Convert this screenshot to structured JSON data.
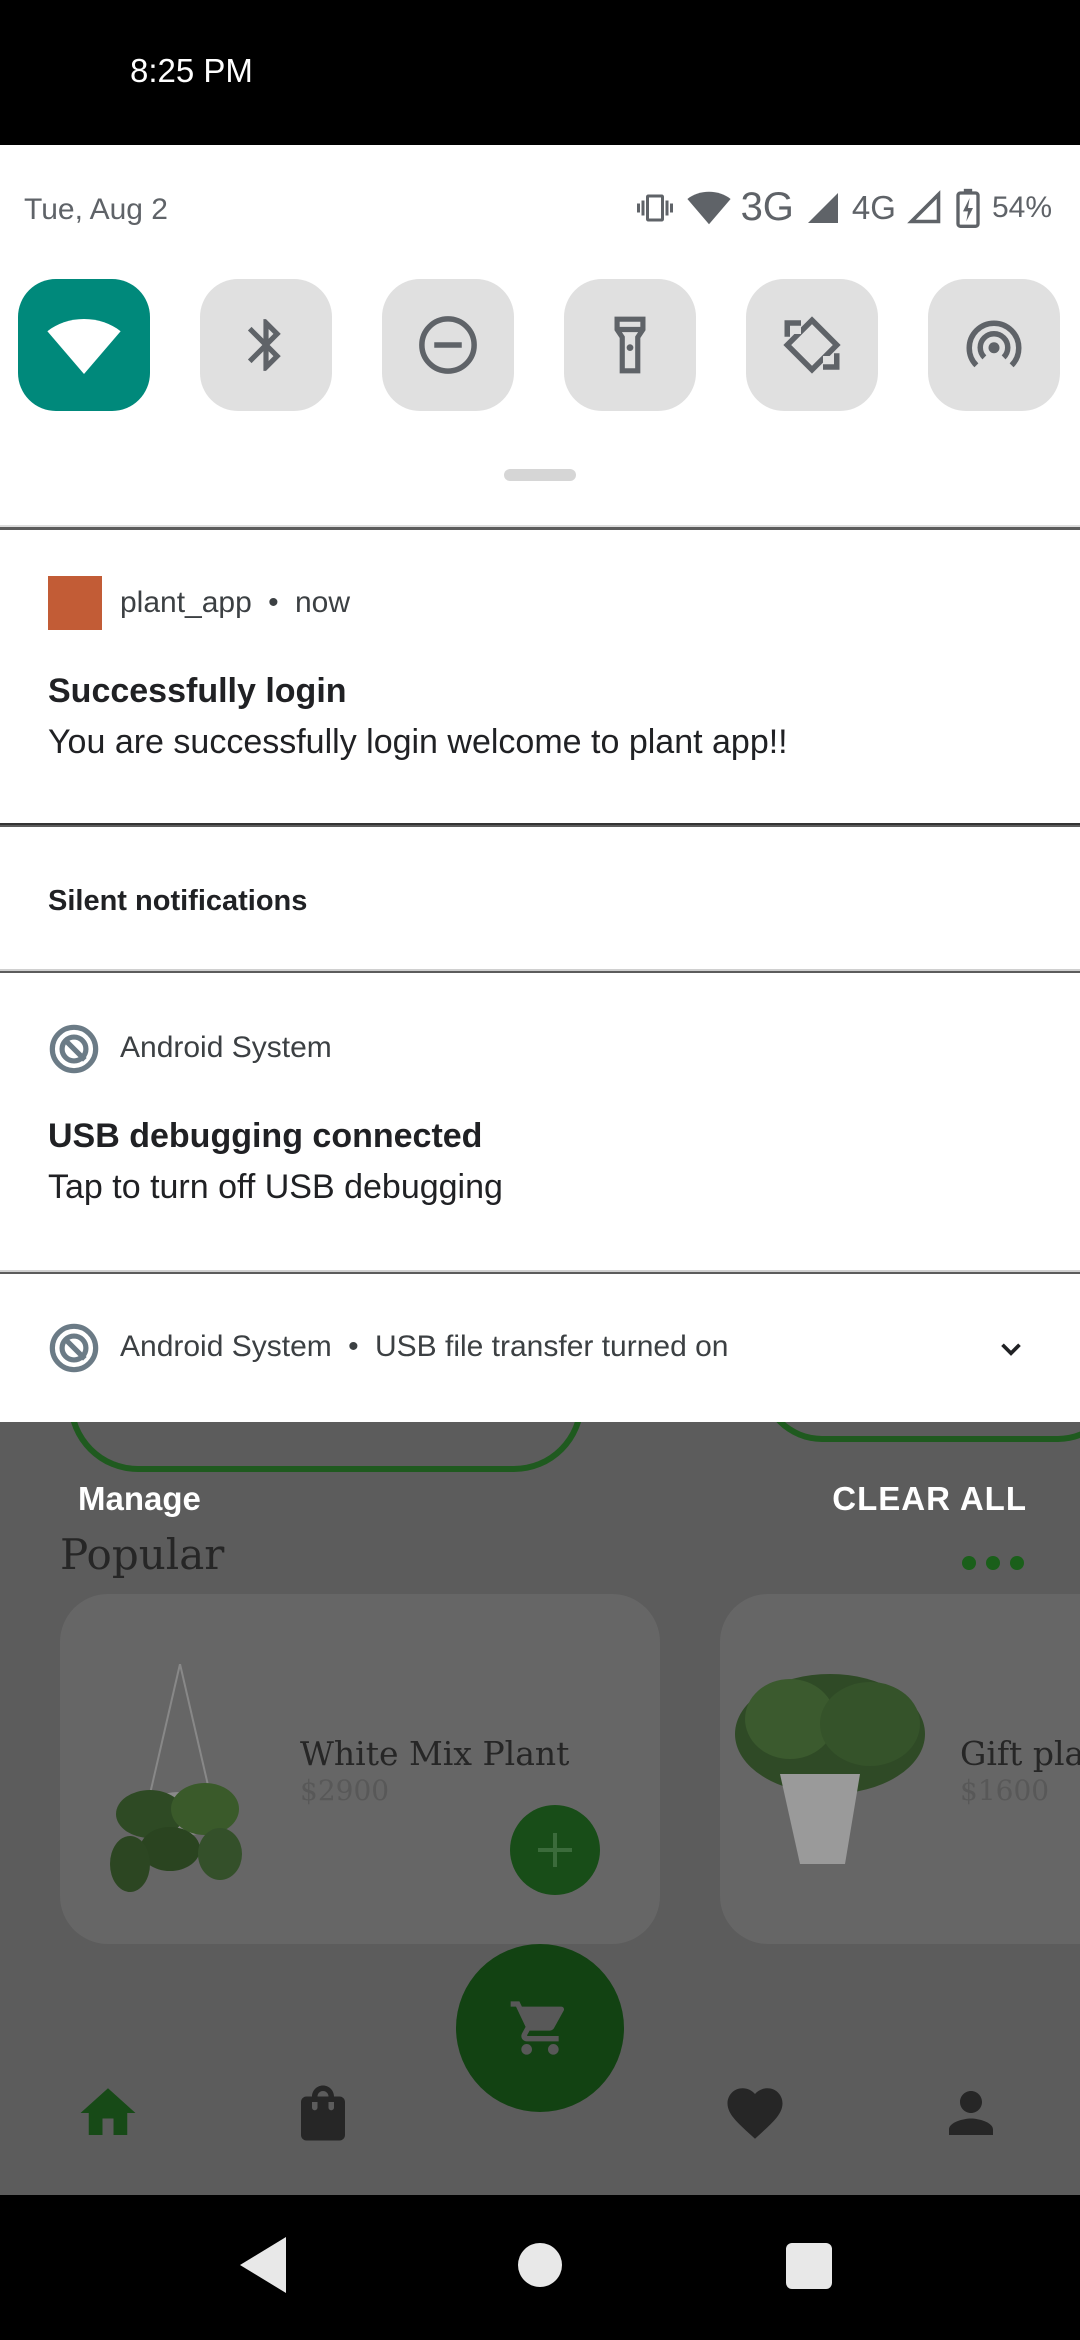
{
  "status_bar": {
    "time": "8:25 PM"
  },
  "quick_settings": {
    "date": "Tue, Aug 2",
    "network_3g": "3G",
    "network_4g": "4G",
    "battery": "54%",
    "tiles": [
      {
        "icon": "wifi-icon",
        "active": true
      },
      {
        "icon": "bluetooth-icon",
        "active": false
      },
      {
        "icon": "do-not-disturb-icon",
        "active": false
      },
      {
        "icon": "flashlight-icon",
        "active": false
      },
      {
        "icon": "auto-rotate-icon",
        "active": false
      },
      {
        "icon": "hotspot-icon",
        "active": false
      }
    ],
    "active_color": "#00897b"
  },
  "notifications": {
    "plant": {
      "app": "plant_app",
      "separator": "•",
      "time": "now",
      "title": "Successfully login",
      "text": "You are successfully login welcome to plant app!!",
      "app_color": "#c25c36"
    },
    "silent_header": "Silent notifications",
    "usb_debug": {
      "app": "Android System",
      "title": "USB debugging connected",
      "text": "Tap to turn off USB debugging"
    },
    "usb_transfer": {
      "app": "Android System",
      "separator": "•",
      "text": "USB file transfer turned on"
    }
  },
  "shade_actions": {
    "manage": "Manage",
    "clear_all": "CLEAR ALL"
  },
  "background_app": {
    "section_title": "Popular",
    "products": [
      {
        "name": "White Mix Plant",
        "price": "$2900"
      },
      {
        "name": "Gift plan",
        "price": "$1600"
      }
    ],
    "accent_color": "#1b5e20"
  }
}
